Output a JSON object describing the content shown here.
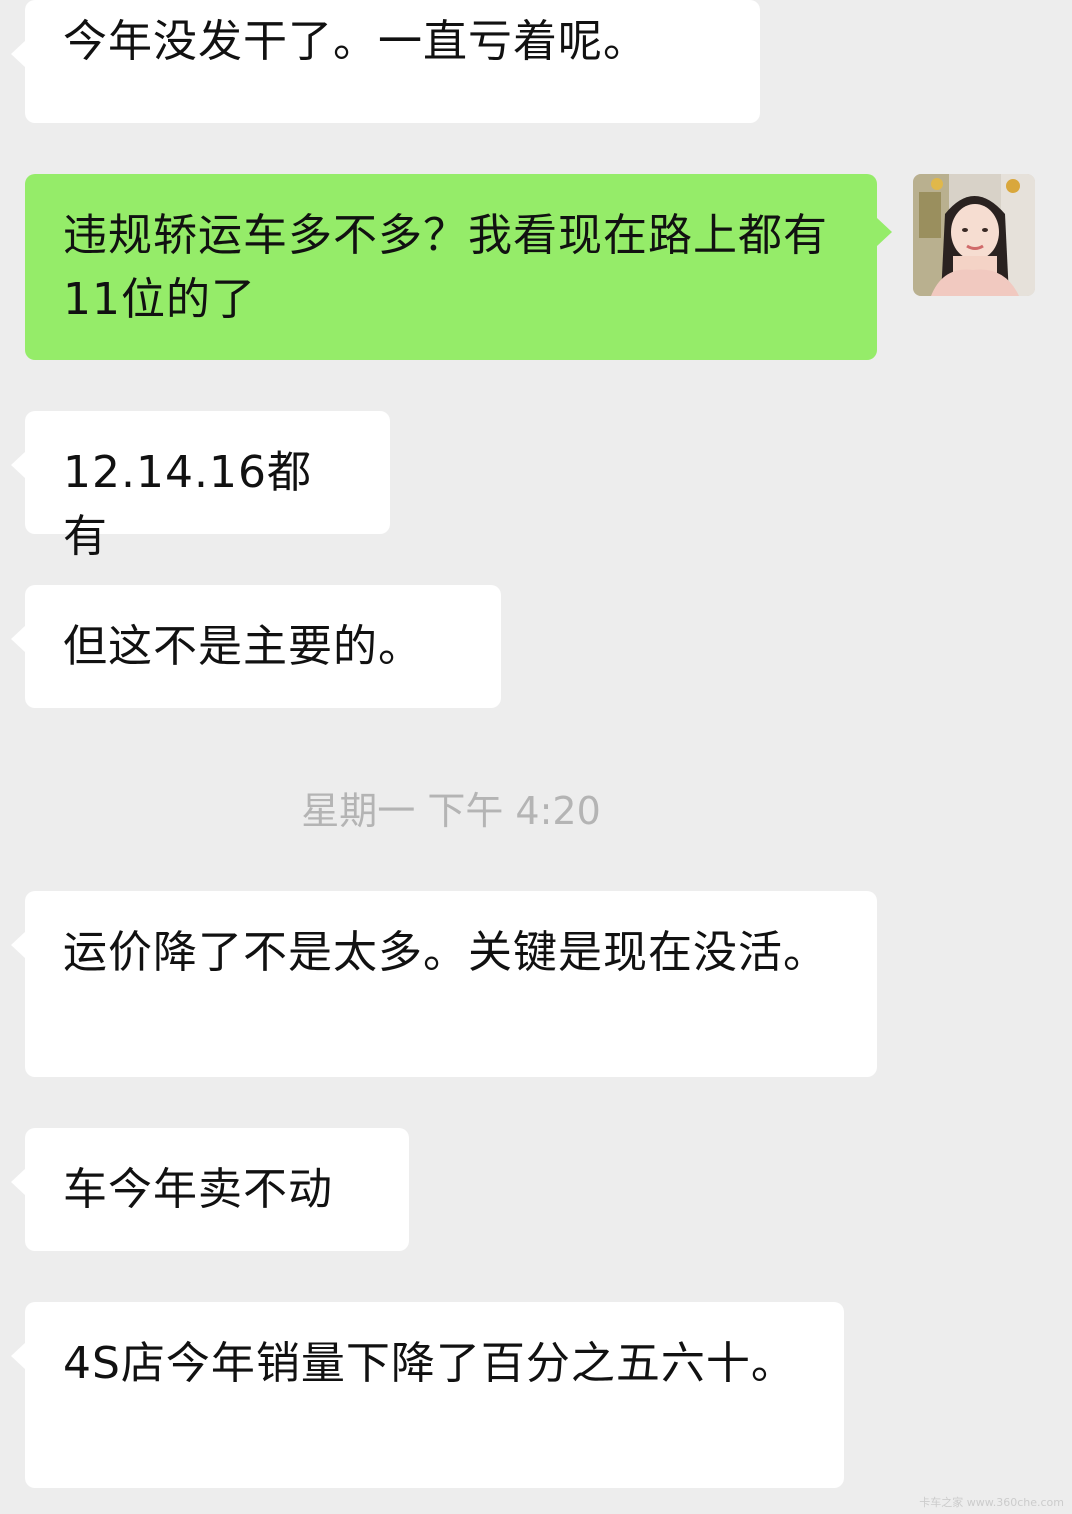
{
  "messages": [
    {
      "text": "今年没发干了。一直亏着呢。"
    },
    {
      "text": "违规轿运车多不多？我看现在路上都有11位的了"
    },
    {
      "text": "12.14.16都有"
    },
    {
      "text": "但这不是主要的。"
    },
    {
      "text": "运价降了不是太多。关键是现在没活。"
    },
    {
      "text": "车今年卖不动"
    },
    {
      "text": "4S店今年销量下降了百分之五六十。"
    }
  ],
  "timestamp": "星期一 下午 4:20",
  "watermark": "卡车之家 www.360che.com",
  "colors": {
    "background": "#ededed",
    "incoming_bubble": "#ffffff",
    "outgoing_bubble": "#95ec69",
    "timestamp_text": "#b4b4b4"
  },
  "avatar_icon": "user-avatar-photo"
}
